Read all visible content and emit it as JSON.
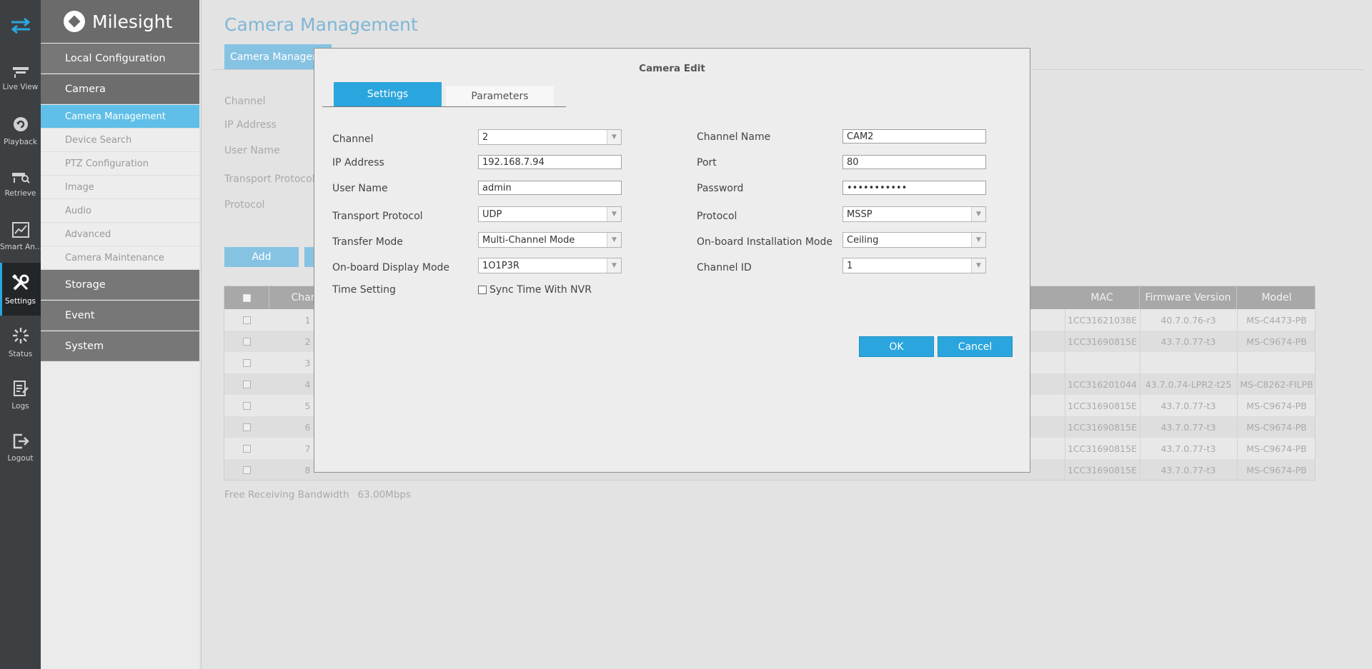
{
  "rail": {
    "items": [
      {
        "label": "Live View",
        "icon": "live-view-icon"
      },
      {
        "label": "Playback",
        "icon": "playback-icon"
      },
      {
        "label": "Retrieve",
        "icon": "retrieve-icon"
      },
      {
        "label": "Smart An...",
        "icon": "smart-analysis-icon"
      },
      {
        "label": "Settings",
        "icon": "settings-icon"
      },
      {
        "label": "Status",
        "icon": "status-icon"
      },
      {
        "label": "Logs",
        "icon": "logs-icon"
      },
      {
        "label": "Logout",
        "icon": "logout-icon"
      }
    ]
  },
  "nav": {
    "brand": "Milesight",
    "sections": {
      "local_configuration": "Local Configuration",
      "camera": "Camera",
      "storage": "Storage",
      "event": "Event",
      "system": "System"
    },
    "camera_items": [
      "Camera Management",
      "Device Search",
      "PTZ Configuration",
      "Image",
      "Audio",
      "Advanced",
      "Camera Maintenance"
    ]
  },
  "main": {
    "title": "Camera Management",
    "tab": "Camera Manageme",
    "labels": {
      "channel": "Channel",
      "ip_address": "IP Address",
      "user_name": "User Name",
      "transport_protocol": "Transport Protocol",
      "protocol": "Protocol"
    },
    "add_button": "Add",
    "table": {
      "headers": {
        "channel": "Chann",
        "mac": "MAC",
        "firmware": "Firmware Version",
        "model": "Model"
      },
      "rows": [
        {
          "ch": "1",
          "mac": "1CC31621038E",
          "fw": "40.7.0.76-r3",
          "model": "MS-C4473-PB"
        },
        {
          "ch": "2",
          "mac": "1CC31690815E",
          "fw": "43.7.0.77-t3",
          "model": "MS-C9674-PB"
        },
        {
          "ch": "3",
          "mac": "",
          "fw": "",
          "model": ""
        },
        {
          "ch": "4",
          "mac": "1CC316201044",
          "fw": "43.7.0.74-LPR2-t25",
          "model": "MS-C8262-FILPB"
        },
        {
          "ch": "5",
          "mac": "1CC31690815E",
          "fw": "43.7.0.77-t3",
          "model": "MS-C9674-PB"
        },
        {
          "ch": "6",
          "mac": "1CC31690815E",
          "fw": "43.7.0.77-t3",
          "model": "MS-C9674-PB"
        },
        {
          "ch": "7",
          "mac": "1CC31690815E",
          "fw": "43.7.0.77-t3",
          "model": "MS-C9674-PB"
        },
        {
          "ch": "8",
          "mac": "1CC31690815E",
          "fw": "43.7.0.77-t3",
          "model": "MS-C9674-PB"
        }
      ]
    },
    "bandwidth_label": "Free Receiving Bandwidth",
    "bandwidth_value": "63.00Mbps"
  },
  "dialog": {
    "title": "Camera Edit",
    "tabs": {
      "settings": "Settings",
      "parameters": "Parameters"
    },
    "fields": {
      "channel": {
        "label": "Channel",
        "value": "2"
      },
      "ip_address": {
        "label": "IP Address",
        "value": "192.168.7.94"
      },
      "user_name": {
        "label": "User Name",
        "value": "admin"
      },
      "transport_protocol": {
        "label": "Transport Protocol",
        "value": "UDP"
      },
      "transfer_mode": {
        "label": "Transfer Mode",
        "value": "Multi-Channel Mode"
      },
      "display_mode": {
        "label": "On-board Display Mode",
        "value": "1O1P3R"
      },
      "time_setting": {
        "label": "Time Setting",
        "checkbox": "Sync Time With NVR"
      },
      "channel_name": {
        "label": "Channel Name",
        "value": "CAM2"
      },
      "port": {
        "label": "Port",
        "value": "80"
      },
      "password": {
        "label": "Password",
        "value": "•••••••••••"
      },
      "protocol": {
        "label": "Protocol",
        "value": "MSSP"
      },
      "installation_mode": {
        "label": "On-board Installation Mode",
        "value": "Ceiling"
      },
      "channel_id": {
        "label": "Channel ID",
        "value": "1"
      }
    },
    "ok": "OK",
    "cancel": "Cancel"
  }
}
